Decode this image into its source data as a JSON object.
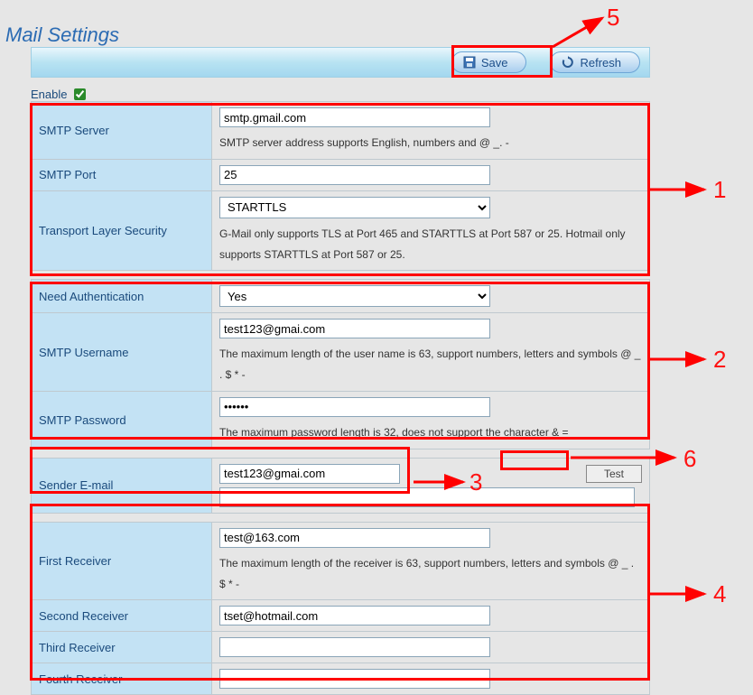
{
  "title": "Mail Settings",
  "toolbar": {
    "save_label": "Save",
    "refresh_label": "Refresh"
  },
  "enable": {
    "label": "Enable",
    "checked": true
  },
  "smtp": {
    "server_label": "SMTP Server",
    "server_value": "smtp.gmail.com",
    "server_hint": "SMTP server address supports English, numbers and @ _. -",
    "port_label": "SMTP Port",
    "port_value": "25",
    "tls_label": "Transport Layer Security",
    "tls_value": "STARTTLS",
    "tls_hint": "G-Mail only supports TLS at Port 465 and STARTTLS at Port 587 or 25. Hotmail only supports STARTTLS at Port 587 or 25."
  },
  "auth": {
    "need_label": "Need Authentication",
    "need_value": "Yes",
    "user_label": "SMTP Username",
    "user_value": "test123@gmai.com",
    "user_hint": "The maximum length of the user name is 63, support numbers, letters and symbols @ _ . $ * -",
    "pass_label": "SMTP Password",
    "pass_value": "••••••",
    "pass_hint": "The maximum password length is 32, does not support the character & ="
  },
  "sender": {
    "label": "Sender E-mail",
    "value": "test123@gmai.com",
    "second_value": "",
    "test_label": "Test"
  },
  "receivers": {
    "r1_label": "First Receiver",
    "r1_value": "test@163.com",
    "r1_hint": "The maximum length of the receiver is 63, support numbers, letters and symbols @ _ . $ * -",
    "r2_label": "Second Receiver",
    "r2_value": "tset@hotmail.com",
    "r3_label": "Third Receiver",
    "r3_value": "",
    "r4_label": "Fourth Receiver",
    "r4_value": ""
  },
  "annotations": {
    "n1": "1",
    "n2": "2",
    "n3": "3",
    "n4": "4",
    "n5": "5",
    "n6": "6"
  }
}
